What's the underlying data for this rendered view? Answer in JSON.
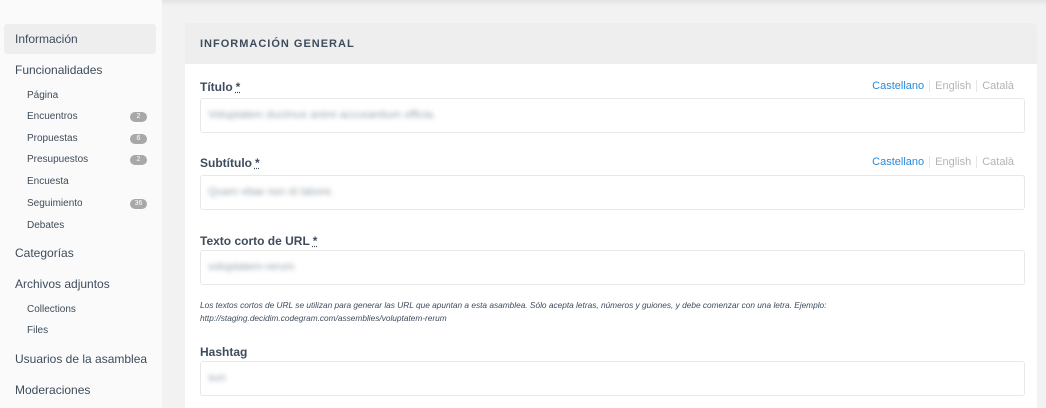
{
  "sidebar": {
    "items": [
      {
        "label": "Información",
        "active": true
      },
      {
        "label": "Funcionalidades"
      },
      {
        "label": "Categorías"
      },
      {
        "label": "Archivos adjuntos"
      },
      {
        "label": "Usuarios de la asamblea"
      },
      {
        "label": "Moderaciones"
      }
    ],
    "components": [
      {
        "label": "Página"
      },
      {
        "label": "Encuentros",
        "badge": "2"
      },
      {
        "label": "Propuestas",
        "badge": "6"
      },
      {
        "label": "Presupuestos",
        "badge": "2"
      },
      {
        "label": "Encuesta"
      },
      {
        "label": "Seguimiento",
        "badge": "36"
      },
      {
        "label": "Debates"
      }
    ],
    "attachments": [
      {
        "label": "Collections"
      },
      {
        "label": "Files"
      }
    ]
  },
  "card": {
    "title": "INFORMACIÓN GENERAL"
  },
  "fields": {
    "title": {
      "label": "Título",
      "required": "*",
      "value": "Voluptatem ducimus animi accusantium officia."
    },
    "subtitle": {
      "label": "Subtítulo",
      "required": "*",
      "value": "Quam vitae non id labore."
    },
    "slug": {
      "label": "Texto corto de URL",
      "required": "*",
      "value": "voluptatem-rerum",
      "help_line1": "Los textos cortos de URL se utilizan para generar las URL que apuntan a esta asamblea. Sólo acepta letras, números y guiones, y debe comenzar con una letra. Ejemplo:",
      "help_line2": "http://staging.decidim.codegram.com/assemblies/voluptatem-rerum"
    },
    "hashtag": {
      "label": "Hashtag",
      "value": "sun"
    }
  },
  "languages": [
    "Castellano",
    "English",
    "Català"
  ],
  "colors": {
    "accent": "#2b8ad8",
    "badge": "#a8a8a8"
  }
}
